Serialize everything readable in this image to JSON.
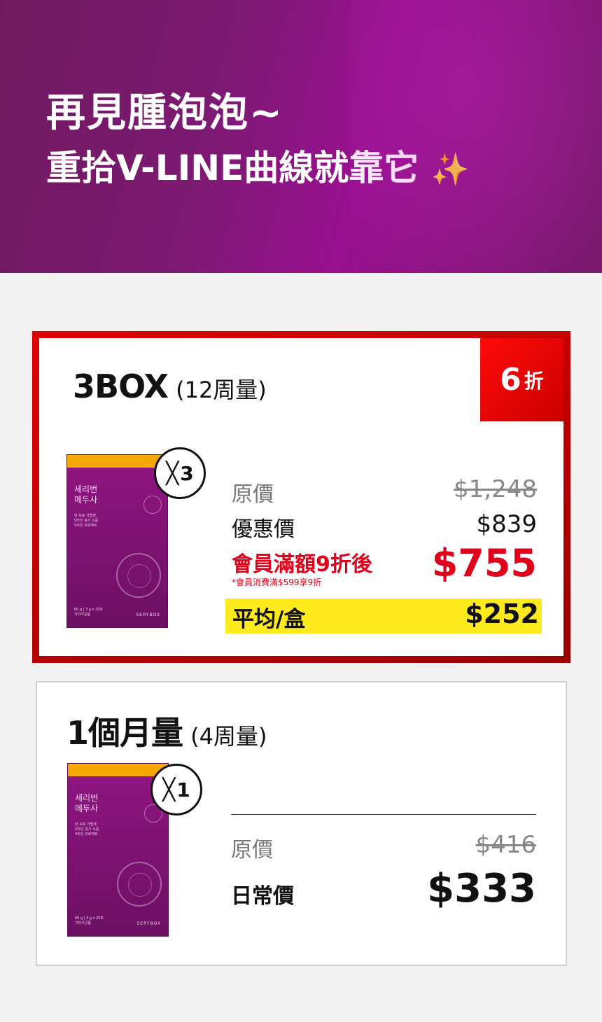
{
  "hero": {
    "line1": "再見腫泡泡~",
    "line2": "重拾V-LINE曲線就靠它",
    "sparkle": "✨"
  },
  "offer1": {
    "title": "3BOX",
    "subtitle": "(12周量)",
    "badge_num": "6",
    "badge_unit": "折",
    "quantity_x": "╳",
    "quantity_n": "3",
    "original_label": "原價",
    "original_price": "$1,248",
    "discount_label": "優惠價",
    "discount_price": "$839",
    "member_label": "會員滿額9折後",
    "member_price": "$755",
    "member_note": "*會員消費滿$599享9折",
    "avg_label": "平均/盒",
    "avg_price": "$252"
  },
  "offer2": {
    "title": "1個月量",
    "subtitle": "(4周量)",
    "quantity_x": "╳",
    "quantity_n": "1",
    "original_label": "原價",
    "original_price": "$416",
    "daily_label": "日常價",
    "daily_price": "$333"
  },
  "product_box": {
    "name_line1": "세리번",
    "name_line2": "메두사",
    "tagline": "탄 모로 가볍게\nV라인 붓기 소중\nV라인 프로젝트",
    "brand": "SERYBOX",
    "weight": "60 g | 3 g x 20포\n기타가공품"
  },
  "colors": {
    "hero_purple": "#7c1a72",
    "accent_red": "#e0001b",
    "highlight_yellow": "#ffea1d"
  }
}
